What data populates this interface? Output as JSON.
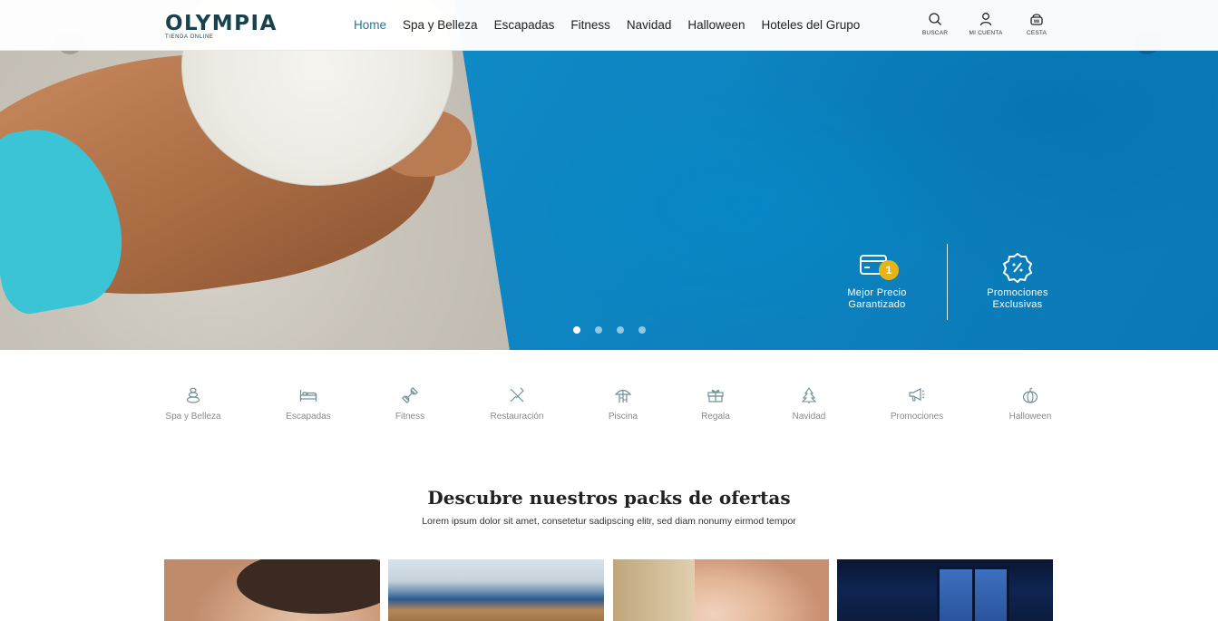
{
  "brand": {
    "name": "OLYMPIA",
    "tagline": "TIENDA ONLINE",
    "color": "#18424d"
  },
  "nav": [
    {
      "label": "Home",
      "active": true
    },
    {
      "label": "Spa y Belleza",
      "active": false
    },
    {
      "label": "Escapadas",
      "active": false
    },
    {
      "label": "Fitness",
      "active": false
    },
    {
      "label": "Navidad",
      "active": false
    },
    {
      "label": "Halloween",
      "active": false
    },
    {
      "label": "Hoteles del Grupo",
      "active": false
    }
  ],
  "tools": {
    "search": {
      "label": "BUSCAR",
      "icon": "search-icon"
    },
    "account": {
      "label": "MI CUENTA",
      "icon": "user-icon"
    },
    "cart": {
      "label": "CESTA",
      "icon": "basket-icon"
    }
  },
  "hero": {
    "badges": [
      {
        "line1": "Mejor Precio",
        "line2": "Garantizado",
        "number": "1",
        "icon": "price-card-icon"
      },
      {
        "line1": "Promociones",
        "line2": "Exclusivas",
        "icon": "percent-badge-icon"
      }
    ],
    "slides_total": 4,
    "active_slide": 1
  },
  "categories": [
    {
      "label": "Spa y Belleza",
      "icon": "spa-stones-icon"
    },
    {
      "label": "Escapadas",
      "icon": "bed-icon"
    },
    {
      "label": "Fitness",
      "icon": "dumbbell-icon"
    },
    {
      "label": "Restauración",
      "icon": "cutlery-icon"
    },
    {
      "label": "Piscina",
      "icon": "pool-umbrella-icon"
    },
    {
      "label": "Regala",
      "icon": "gift-icon"
    },
    {
      "label": "Navidad",
      "icon": "christmas-tree-icon"
    },
    {
      "label": "Promociones",
      "icon": "megaphone-icon"
    },
    {
      "label": "Halloween",
      "icon": "pumpkin-icon"
    }
  ],
  "offers": {
    "title": "Descubre nuestros packs de ofertas",
    "subtitle": "Lorem ipsum dolor sit amet, consetetur sadipscing elitr, sed diam nonumy eirmod tempor"
  },
  "colors": {
    "accent": "#1f7a94",
    "badge_yellow": "#e7b418",
    "pool_blue": "#0e86c3"
  }
}
